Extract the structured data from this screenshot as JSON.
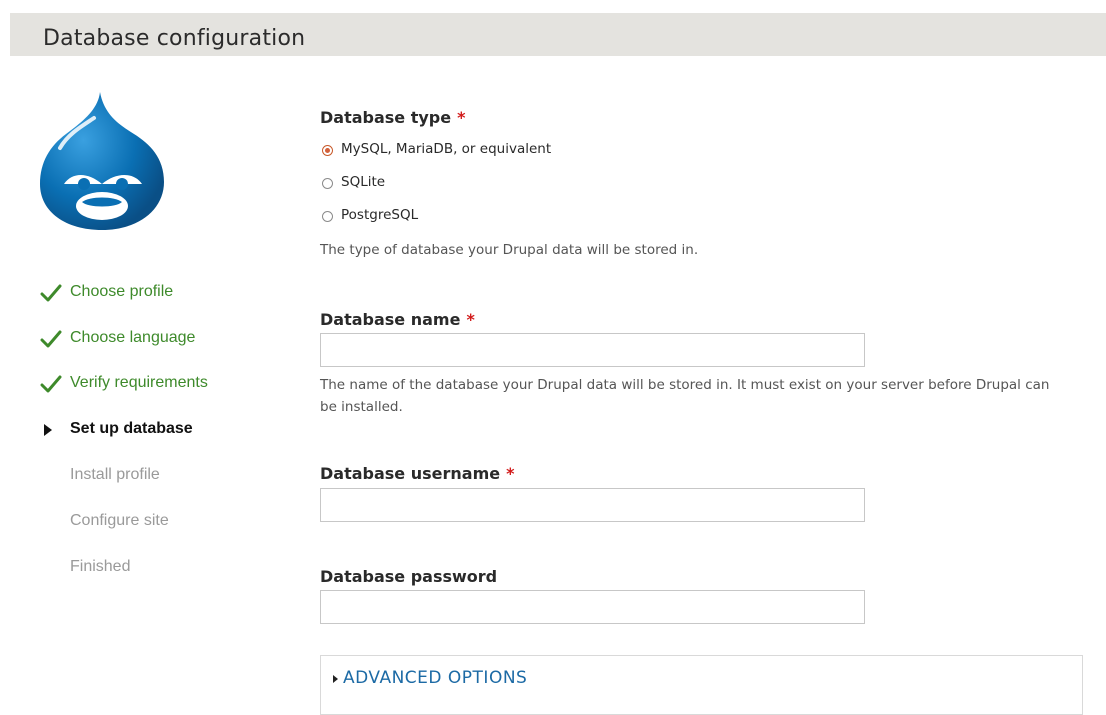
{
  "header": {
    "title": "Database configuration"
  },
  "logo": {
    "icon": "drupal-drop-logo",
    "color": "#0678be"
  },
  "steps": [
    {
      "label": "Choose profile",
      "state": "done"
    },
    {
      "label": "Choose language",
      "state": "done"
    },
    {
      "label": "Verify requirements",
      "state": "done"
    },
    {
      "label": "Set up database",
      "state": "active"
    },
    {
      "label": "Install profile",
      "state": "pending"
    },
    {
      "label": "Configure site",
      "state": "pending"
    },
    {
      "label": "Finished",
      "state": "pending"
    }
  ],
  "form": {
    "db_type": {
      "label": "Database type",
      "required_marker": "*",
      "options": [
        {
          "label": "MySQL, MariaDB, or equivalent",
          "checked": true
        },
        {
          "label": "SQLite",
          "checked": false
        },
        {
          "label": "PostgreSQL",
          "checked": false
        }
      ],
      "description": "The type of database your Drupal data will be stored in."
    },
    "db_name": {
      "label": "Database name",
      "required_marker": "*",
      "value": "",
      "description": "The name of the database your Drupal data will be stored in. It must exist on your server before Drupal can be installed."
    },
    "db_username": {
      "label": "Database username",
      "required_marker": "*",
      "value": ""
    },
    "db_password": {
      "label": "Database password",
      "value": ""
    },
    "advanced": {
      "label": "ADVANCED OPTIONS"
    }
  },
  "colors": {
    "done": "#3e8a2b",
    "pending": "#9a9a9a",
    "required": "#d21a1a",
    "link": "#1c6aa5",
    "header_bg": "#e4e3df"
  }
}
